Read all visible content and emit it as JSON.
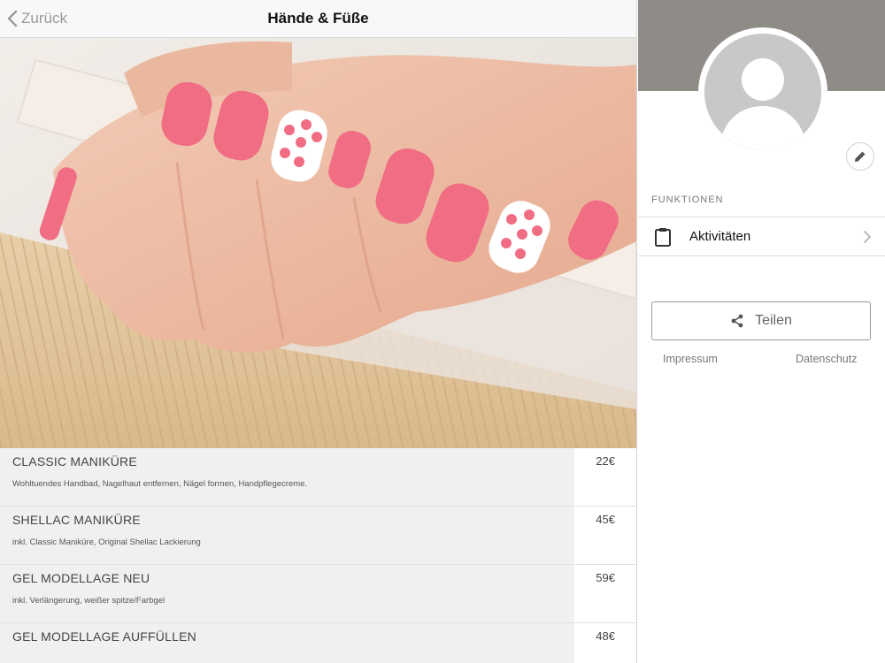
{
  "navbar": {
    "back_label": "Zurück",
    "title": "Hände & Füße"
  },
  "hero": {
    "description": "Manicured hands with pink polish holding a nail file"
  },
  "services": [
    {
      "name": "CLASSIC MANIKÜRE",
      "description": "Wohltuendes Handbad, Nagelhaut entfernen, Nägel formen, Handpflegecreme.",
      "price": "22€"
    },
    {
      "name": "SHELLAC MANIKÜRE",
      "description": "inkl. Classic Maniküre, Original Shellac Lackierung",
      "price": "45€"
    },
    {
      "name": "GEL MODELLAGE NEU",
      "description": "inkl. Verlängerung, weißer spitze/Farbgel",
      "price": "59€"
    },
    {
      "name": "GEL MODELLAGE AUFFÜLLEN",
      "description": "",
      "price": "48€"
    }
  ],
  "sidebar": {
    "section_label": "FUNKTIONEN",
    "menu": [
      {
        "label": "Aktivitäten",
        "icon": "clipboard-icon"
      }
    ],
    "share_label": "Teilen",
    "footer_links": [
      "Impressum",
      "Datenschutz"
    ]
  },
  "colors": {
    "cover": "#8f8b87",
    "avatar_bg": "#c8c8c8",
    "nail_pink": "#f06d84"
  }
}
